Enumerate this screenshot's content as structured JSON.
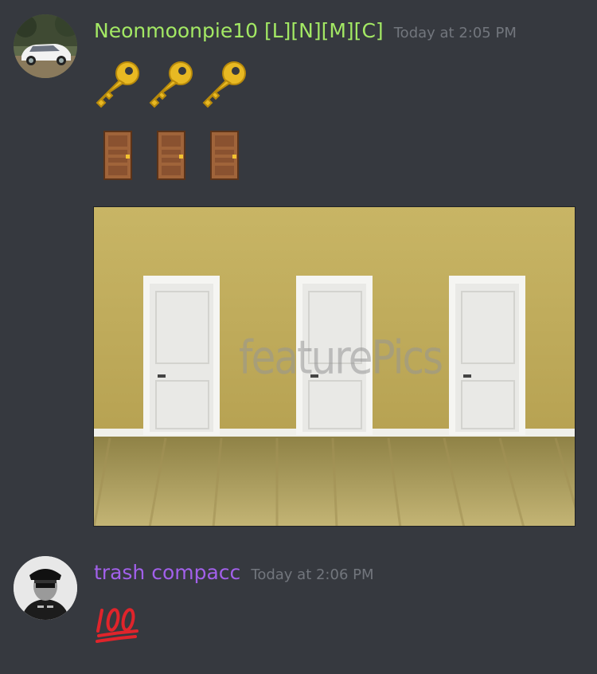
{
  "messages": [
    {
      "author": "Neonmoonpie10 [L][N][M][C]",
      "author_color": "#a3e864",
      "timestamp": "Today at 2:05 PM",
      "avatar_icon": "car-avatar",
      "content_rows": [
        {
          "icons": [
            "key-emoji",
            "key-emoji",
            "key-emoji"
          ]
        },
        {
          "icons": [
            "door-emoji",
            "door-emoji",
            "door-emoji"
          ]
        }
      ],
      "attachment": {
        "type": "image",
        "description_icon": "three-doors-image",
        "watermark": "featurePics"
      }
    },
    {
      "author": "trash compacc",
      "author_color": "#a260ea",
      "timestamp": "Today at 2:06 PM",
      "avatar_icon": "officer-avatar",
      "content_rows": [
        {
          "icons": [
            "hundred-points-emoji"
          ]
        }
      ]
    }
  ],
  "colors": {
    "background": "#36393f",
    "timestamp": "#72767d"
  }
}
